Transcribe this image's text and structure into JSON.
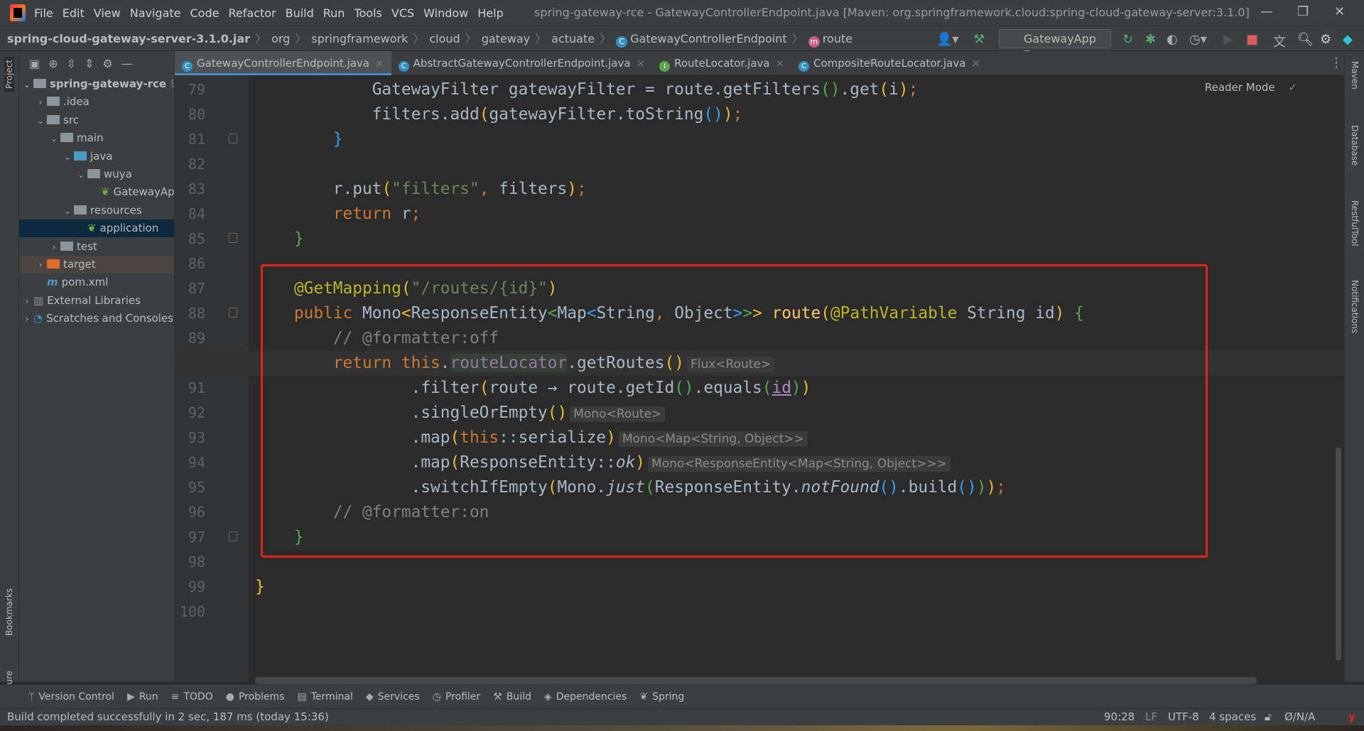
{
  "window": {
    "menu": [
      "File",
      "Edit",
      "View",
      "Navigate",
      "Code",
      "Refactor",
      "Build",
      "Run",
      "Tools",
      "VCS",
      "Window",
      "Help"
    ],
    "title": "spring-gateway-rce - GatewayControllerEndpoint.java [Maven: org.springframework.cloud:spring-cloud-gateway-server:3.1.0]"
  },
  "breadcrumb": [
    "spring-cloud-gateway-server-3.1.0.jar",
    "org",
    "springframework",
    "cloud",
    "gateway",
    "actuate",
    "GatewayControllerEndpoint",
    "route"
  ],
  "toolbar": {
    "run_config": "GatewayApp"
  },
  "tool_windows": {
    "left_top": "Project",
    "left_bottom": [
      "Bookmarks",
      "Structure"
    ],
    "right": [
      "Maven",
      "Database",
      "RestfulTool",
      "Notifications"
    ]
  },
  "project_tree": [
    {
      "label": "spring-gateway-rce",
      "suffix": "E",
      "level": 0,
      "expanded": true,
      "bold": true,
      "icon": "module"
    },
    {
      "label": ".idea",
      "level": 1,
      "expanded": false,
      "icon": "folder"
    },
    {
      "label": "src",
      "level": 1,
      "expanded": true,
      "icon": "folder"
    },
    {
      "label": "main",
      "level": 2,
      "expanded": true,
      "icon": "folder"
    },
    {
      "label": "java",
      "level": 3,
      "expanded": true,
      "icon": "folder-blue"
    },
    {
      "label": "wuya",
      "level": 4,
      "expanded": true,
      "icon": "package"
    },
    {
      "label": "GatewayApp",
      "level": 5,
      "icon": "spring-boot-class"
    },
    {
      "label": "resources",
      "level": 3,
      "expanded": true,
      "icon": "folder-resources"
    },
    {
      "label": "application",
      "level": 4,
      "icon": "spring-config",
      "selected": true
    },
    {
      "label": "test",
      "level": 2,
      "expanded": false,
      "icon": "folder"
    },
    {
      "label": "target",
      "level": 1,
      "expanded": false,
      "icon": "folder-orange",
      "excluded": true
    },
    {
      "label": "pom.xml",
      "level": 1,
      "icon": "maven"
    },
    {
      "label": "External Libraries",
      "level": 0,
      "expanded": false,
      "icon": "libraries"
    },
    {
      "label": "Scratches and Consoles",
      "level": 0,
      "expanded": false,
      "icon": "scratches"
    }
  ],
  "tabs": [
    {
      "label": "GatewayControllerEndpoint.java",
      "icon": "class",
      "active": true
    },
    {
      "label": "AbstractGatewayControllerEndpoint.java",
      "icon": "class"
    },
    {
      "label": "RouteLocator.java",
      "icon": "interface"
    },
    {
      "label": "CompositeRouteLocator.java",
      "icon": "class"
    }
  ],
  "editor": {
    "reader_mode": "Reader Mode",
    "current_line": 90,
    "lines": [
      {
        "n": "79",
        "t": [
          [
            "            GatewayFilter gatewayFilter = route.getFilters",
            ""
          ],
          [
            "()",
            "p2"
          ],
          [
            ".get",
            ""
          ],
          [
            "(",
            "p1"
          ],
          [
            "i",
            ""
          ],
          [
            ")",
            "p1"
          ],
          [
            ";",
            "kw"
          ]
        ]
      },
      {
        "n": "80",
        "t": [
          [
            "            filters.add",
            ""
          ],
          [
            "(",
            "p1"
          ],
          [
            "gatewayFilter.toString",
            ""
          ],
          [
            "()",
            "p3"
          ],
          [
            ")",
            "p1"
          ],
          [
            ";",
            "kw"
          ]
        ]
      },
      {
        "n": "81",
        "t": [
          [
            "        ",
            ""
          ],
          [
            "}",
            "p3"
          ]
        ]
      },
      {
        "n": "82",
        "t": []
      },
      {
        "n": "83",
        "t": [
          [
            "        r.put",
            ""
          ],
          [
            "(",
            "p1"
          ],
          [
            "\"filters\"",
            "str"
          ],
          [
            ",",
            "kw"
          ],
          [
            " filters",
            ""
          ],
          [
            ")",
            "p1"
          ],
          [
            ";",
            "kw"
          ]
        ]
      },
      {
        "n": "84",
        "t": [
          [
            "        ",
            ""
          ],
          [
            "return",
            "kw"
          ],
          [
            " r",
            ""
          ],
          [
            ";",
            "kw"
          ]
        ]
      },
      {
        "n": "85",
        "t": [
          [
            "    ",
            ""
          ],
          [
            "}",
            "p2"
          ]
        ]
      },
      {
        "n": "86",
        "t": []
      },
      {
        "n": "87",
        "t": [
          [
            "    ",
            ""
          ],
          [
            "@GetMapping",
            "an"
          ],
          [
            "(",
            "p1"
          ],
          [
            "\"/routes/{id}\"",
            "str"
          ],
          [
            ")",
            "p1"
          ]
        ]
      },
      {
        "n": "88",
        "t": [
          [
            "    ",
            ""
          ],
          [
            "public",
            "kw"
          ],
          [
            " Mono",
            ""
          ],
          [
            "<",
            "p1"
          ],
          [
            "ResponseEntity",
            ""
          ],
          [
            "<",
            "p2"
          ],
          [
            "Map",
            ""
          ],
          [
            "<",
            "p3"
          ],
          [
            "String",
            ""
          ],
          [
            ",",
            "kw"
          ],
          [
            " Object",
            ""
          ],
          [
            ">",
            "p3"
          ],
          [
            ">",
            "p2"
          ],
          [
            ">",
            "p1"
          ],
          [
            " ",
            ""
          ],
          [
            "route",
            "md"
          ],
          [
            "(",
            "p1"
          ],
          [
            "@PathVariable",
            "an"
          ],
          [
            " String id",
            ""
          ],
          [
            ")",
            "p1"
          ],
          [
            " ",
            ""
          ],
          [
            "{",
            "p2"
          ]
        ]
      },
      {
        "n": "89",
        "t": [
          [
            "        ",
            ""
          ],
          [
            "// @formatter:off",
            "cm"
          ]
        ]
      },
      {
        "n": "90",
        "t": [
          [
            "        ",
            ""
          ],
          [
            "return this",
            "kw"
          ],
          [
            ".",
            ""
          ],
          [
            "routeLocator",
            "fdb"
          ],
          [
            ".getRoutes",
            ""
          ],
          [
            "()",
            "p1"
          ]
        ],
        "hint": "Flux<Route>"
      },
      {
        "n": "91",
        "t": [
          [
            "                .filter",
            ""
          ],
          [
            "(",
            "p1"
          ],
          [
            "route → route.getId",
            ""
          ],
          [
            "()",
            "p2"
          ],
          [
            ".equals",
            ""
          ],
          [
            "(",
            "p2"
          ],
          [
            "id",
            "pr"
          ],
          [
            ")",
            "p2"
          ],
          [
            ")",
            "p1"
          ]
        ]
      },
      {
        "n": "92",
        "t": [
          [
            "                .singleOrEmpty",
            ""
          ],
          [
            "()",
            "p1"
          ]
        ],
        "hint": "Mono<Route>"
      },
      {
        "n": "93",
        "t": [
          [
            "                .map",
            ""
          ],
          [
            "(",
            "p1"
          ],
          [
            "this",
            "kw"
          ],
          [
            "::serialize",
            ""
          ],
          [
            ")",
            "p1"
          ]
        ],
        "hint": "Mono<Map<String, Object>>"
      },
      {
        "n": "94",
        "t": [
          [
            "                .map",
            ""
          ],
          [
            "(",
            "p1"
          ],
          [
            "ResponseEntity::",
            ""
          ],
          [
            "ok",
            "it"
          ],
          [
            ")",
            "p1"
          ]
        ],
        "hint": "Mono<ResponseEntity<Map<String, Object>>>"
      },
      {
        "n": "95",
        "t": [
          [
            "                .switchIfEmpty",
            ""
          ],
          [
            "(",
            "p1"
          ],
          [
            "Mono.",
            ""
          ],
          [
            "just",
            "it"
          ],
          [
            "(",
            "p2"
          ],
          [
            "ResponseEntity.",
            ""
          ],
          [
            "notFound",
            "it"
          ],
          [
            "()",
            "p3"
          ],
          [
            ".build",
            ""
          ],
          [
            "()",
            "p3"
          ],
          [
            ")",
            "p2"
          ],
          [
            ")",
            "p1"
          ],
          [
            ";",
            "kw"
          ]
        ]
      },
      {
        "n": "96",
        "t": [
          [
            "        ",
            ""
          ],
          [
            "// @formatter:on",
            "cm"
          ]
        ]
      },
      {
        "n": "97",
        "t": [
          [
            "    ",
            ""
          ],
          [
            "}",
            "p2"
          ]
        ]
      },
      {
        "n": "98",
        "t": []
      },
      {
        "n": "99",
        "t": [
          [
            "}",
            "p1"
          ]
        ]
      },
      {
        "n": "100",
        "t": []
      }
    ]
  },
  "bottom_tools": [
    "Version Control",
    "Run",
    "TODO",
    "Problems",
    "Terminal",
    "Services",
    "Profiler",
    "Build",
    "Dependencies",
    "Spring"
  ],
  "status": {
    "message": "Build completed successfully in 2 sec, 187 ms (today 15:36)",
    "position": "90:28",
    "line_sep": "LF",
    "encoding": "UTF-8",
    "indent": "4 spaces",
    "vcs": "Ø/N/A"
  },
  "colors": {
    "background": "#2b2b2b",
    "highlight_box": "#e5231d",
    "keyword": "#cc7832",
    "string": "#6a8759",
    "annotation": "#bbb529"
  }
}
